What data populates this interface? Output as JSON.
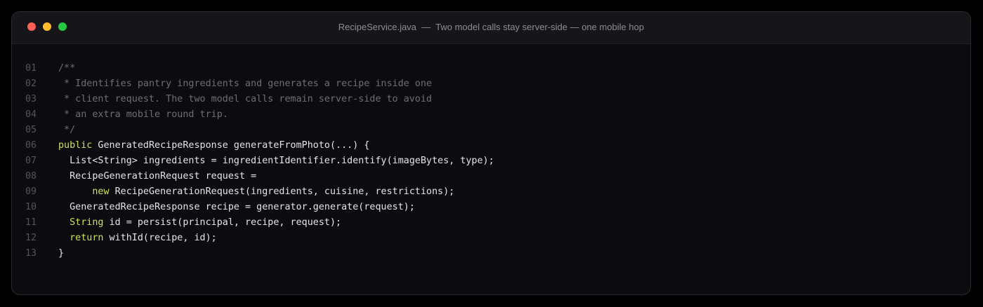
{
  "window": {
    "title": "RecipeService.java  —  Two model calls stay server-side — one mobile hop",
    "controls": [
      {
        "name": "close",
        "color": "#ff5f57"
      },
      {
        "name": "minimize",
        "color": "#febc2e"
      },
      {
        "name": "maximize",
        "color": "#28c840"
      }
    ]
  },
  "editor": {
    "language": "java",
    "lines": [
      {
        "num": "01",
        "tokens": [
          {
            "t": "/**",
            "c": "comment"
          }
        ]
      },
      {
        "num": "02",
        "tokens": [
          {
            "t": " * Identifies pantry ingredients and generates a recipe inside one",
            "c": "comment"
          }
        ]
      },
      {
        "num": "03",
        "tokens": [
          {
            "t": " * client request. The two model calls remain server-side to avoid",
            "c": "comment"
          }
        ]
      },
      {
        "num": "04",
        "tokens": [
          {
            "t": " * an extra mobile round trip.",
            "c": "comment"
          }
        ]
      },
      {
        "num": "05",
        "tokens": [
          {
            "t": " */",
            "c": "comment"
          }
        ]
      },
      {
        "num": "06",
        "tokens": [
          {
            "t": "public",
            "c": "keyword"
          },
          {
            "t": " GeneratedRecipeResponse generateFromPhoto(...) {",
            "c": "plain"
          }
        ]
      },
      {
        "num": "07",
        "tokens": [
          {
            "t": "  List<String> ingredients = ingredientIdentifier.identify(imageBytes, type);",
            "c": "plain"
          }
        ]
      },
      {
        "num": "08",
        "tokens": [
          {
            "t": "  RecipeGenerationRequest request =",
            "c": "plain"
          }
        ]
      },
      {
        "num": "09",
        "tokens": [
          {
            "t": "      ",
            "c": "plain"
          },
          {
            "t": "new",
            "c": "keyword"
          },
          {
            "t": " RecipeGenerationRequest(ingredients, cuisine, restrictions);",
            "c": "plain"
          }
        ]
      },
      {
        "num": "10",
        "tokens": [
          {
            "t": "  GeneratedRecipeResponse recipe = generator.generate(request);",
            "c": "plain"
          }
        ]
      },
      {
        "num": "11",
        "tokens": [
          {
            "t": "  ",
            "c": "plain"
          },
          {
            "t": "String",
            "c": "keyword"
          },
          {
            "t": " id = persist(principal, recipe, request);",
            "c": "plain"
          }
        ]
      },
      {
        "num": "12",
        "tokens": [
          {
            "t": "  ",
            "c": "plain"
          },
          {
            "t": "return",
            "c": "keyword"
          },
          {
            "t": " withId(recipe, id);",
            "c": "plain"
          }
        ]
      },
      {
        "num": "13",
        "tokens": [
          {
            "t": "}",
            "c": "plain"
          }
        ]
      }
    ]
  }
}
